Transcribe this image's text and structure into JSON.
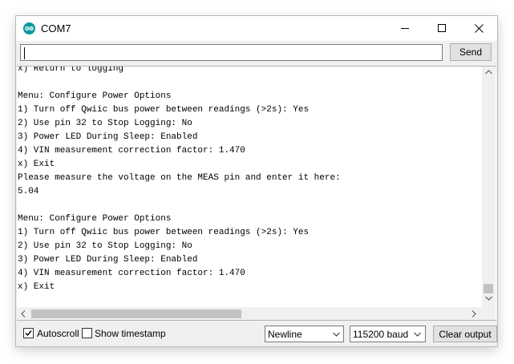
{
  "window": {
    "title": "COM7",
    "icon": "arduino-icon",
    "accent_color": "#00979c",
    "controls": [
      "minimize-icon",
      "maximize-icon",
      "close-icon"
    ]
  },
  "input": {
    "value": "",
    "send_label": "Send"
  },
  "output": {
    "lines": [
      "x) Return to logging",
      "",
      "Menu: Configure Power Options",
      "1) Turn off Qwiic bus power between readings (>2s): Yes",
      "2) Use pin 32 to Stop Logging: No",
      "3) Power LED During Sleep: Enabled",
      "4) VIN measurement correction factor: 1.470",
      "x) Exit",
      "Please measure the voltage on the MEAS pin and enter it here:",
      "5.04",
      "",
      "Menu: Configure Power Options",
      "1) Turn off Qwiic bus power between readings (>2s): Yes",
      "2) Use pin 32 to Stop Logging: No",
      "3) Power LED During Sleep: Enabled",
      "4) VIN measurement correction factor: 1.470",
      "x) Exit"
    ]
  },
  "footer": {
    "autoscroll_label": "Autoscroll",
    "autoscroll_checked": true,
    "timestamp_label": "Show timestamp",
    "timestamp_checked": false,
    "line_ending": "Newline",
    "baud": "115200 baud",
    "clear_label": "Clear output"
  }
}
